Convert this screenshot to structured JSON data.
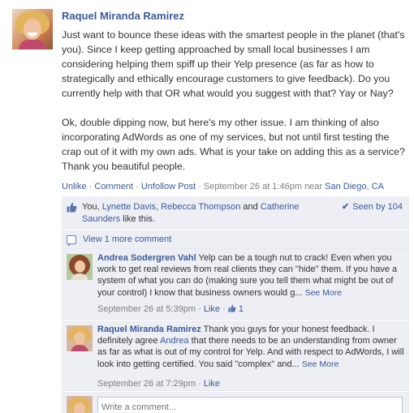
{
  "post": {
    "author": "Raquel Miranda Ramirez",
    "paragraphs": [
      "Just want to bounce these ideas with the smartest people in the planet (that's you). Since I keep getting approached by small local businesses I am considering helping them spiff up their Yelp presence (as far as how to strategically and ethically encourage customers to give feedback). Do you currently help with that OR what would you suggest with that? Yay or Nay?",
      "Ok, double dipping now, but here's my other issue. I am thinking of also incorporating AdWords as one of my services, but not until first testing the crap out of it with my own ads. What is your take on adding this as a service? Thank you beautiful people."
    ],
    "actions": {
      "unlike": "Unlike",
      "comment": "Comment",
      "unfollow": "Unfollow Post"
    },
    "timestamp": "September 26 at 1:46pm",
    "near": "near",
    "location": "San Diego, CA"
  },
  "likes": {
    "you": "You",
    "name1": "Lynette Davis",
    "name2": "Rebecca Thompson",
    "and": "and",
    "name3": "Catherine Saunders",
    "suffix": "like this.",
    "seen_by": "Seen by 104"
  },
  "view_more": "View 1 more comment",
  "comments": [
    {
      "author": "Andrea Sodergren Vahl",
      "text": "Yelp can be a tough nut to crack! Even when you work to get real reviews from real clients they can \"hide\" them. If you have a system of what you can do (making sure you tell them what might be out of your control) I know that business owners would g...",
      "see_more": "See More",
      "time": "September 26 at 5:39pm",
      "like": "Like",
      "like_count": "1"
    },
    {
      "author": "Raquel Miranda Ramirez",
      "text_before": "Thank you guys for your honest feedback. I definitely agree",
      "mention": "Andrea",
      "text_after": "that there needs to be an understanding from owner as far as what is out of my control for Yelp. And with respect to AdWords, I will look into getting certified. You said \"complex\" and...",
      "see_more": "See More",
      "time": "September 26 at 7:29pm",
      "like": "Like"
    }
  ],
  "write_placeholder": "Write a comment...",
  "colors": {
    "link": "#3b5998",
    "ufi_background": "#edeff4",
    "meta_gray": "#808080"
  }
}
